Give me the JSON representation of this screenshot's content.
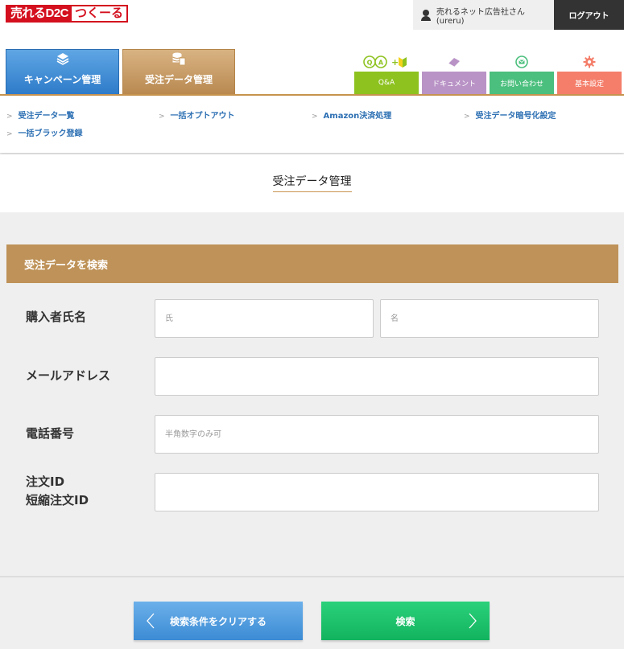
{
  "header": {
    "logo_part1": "売れるD2C",
    "logo_part2": "つくーる",
    "user_label": "売れるネット広告社さん (ureru)",
    "logout_label": "ログアウト"
  },
  "main_tabs": [
    {
      "label": "キャンペーン管理",
      "icon": "layers-icon",
      "color": "#2e7bc9"
    },
    {
      "label": "受注データ管理",
      "icon": "database-document-icon",
      "color": "#b98950"
    }
  ],
  "util_tabs": [
    {
      "label": "Q&A",
      "icon": "qa-beginner-icon",
      "color": "#8dc21f"
    },
    {
      "label": "ドキュメント",
      "icon": "eraser-icon",
      "color": "#b993c6"
    },
    {
      "label": "お問い合わせ",
      "icon": "mail-icon",
      "color": "#4bbf7d"
    },
    {
      "label": "基本設定",
      "icon": "gear-icon",
      "color": "#f47e6a"
    }
  ],
  "subnav": [
    "受注データ一覧",
    "一括オプトアウト",
    "Amazon決済処理",
    "受注データ暗号化設定",
    "一括ブラック登録"
  ],
  "page_title": "受注データ管理",
  "search": {
    "heading": "受注データを検索",
    "name_label": "購入者氏名",
    "last_name_placeholder": "氏",
    "first_name_placeholder": "名",
    "email_label": "メールアドレス",
    "email_placeholder": "",
    "phone_label": "電話番号",
    "phone_placeholder": "半角数字のみ可",
    "order_id_label_1": "注文ID",
    "order_id_label_2": "短縮注文ID",
    "order_id_placeholder": ""
  },
  "buttons": {
    "clear_label": "検索条件をクリアする",
    "search_label": "検索"
  }
}
